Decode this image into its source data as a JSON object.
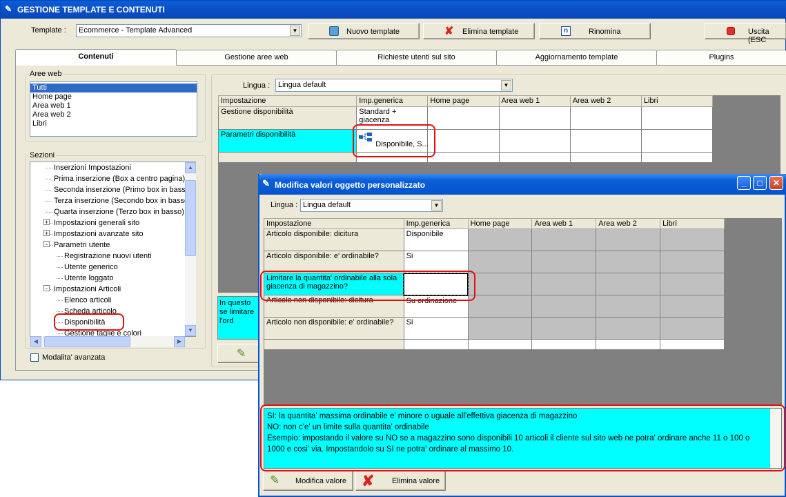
{
  "main_window": {
    "title": "GESTIONE TEMPLATE E CONTENUTI",
    "template_label": "Template :",
    "template_value": "Ecommerce - Template Advanced",
    "buttons": {
      "new_template": "Nuovo template",
      "delete_template": "Elimina template",
      "rename": "Rinomina",
      "exit": "Uscita (ESC"
    },
    "tabs": [
      "Contenuti",
      "Gestione aree web",
      "Richieste utenti sul sito",
      "Aggiornamento template",
      "Plugins"
    ],
    "aree_web": {
      "label": "Aree web",
      "items": [
        "Tutti",
        "Home page",
        "Area web 1",
        "Area web 2",
        "Libri"
      ],
      "selected": 0
    },
    "sezioni": {
      "label": "Sezioni",
      "items": [
        {
          "text": "Inserzioni Impostazioni",
          "indent": 1
        },
        {
          "text": "Prima inserzione (Box a centro pagina)",
          "indent": 1
        },
        {
          "text": "Seconda inserzione (Primo box in basso)",
          "indent": 1
        },
        {
          "text": "Terza inserzione (Secondo box in basso)",
          "indent": 1
        },
        {
          "text": "Quarta inserzione (Terzo box in basso)",
          "indent": 1
        },
        {
          "text": "Impostazioni generali sito",
          "indent": 1,
          "expander": "+"
        },
        {
          "text": "Impostazioni avanzate sito",
          "indent": 1,
          "expander": "+"
        },
        {
          "text": "Parametri utente",
          "indent": 1,
          "expander": "-"
        },
        {
          "text": "Registrazione nuovi utenti",
          "indent": 2
        },
        {
          "text": "Utente generico",
          "indent": 2
        },
        {
          "text": "Utente loggato",
          "indent": 2
        },
        {
          "text": "Impostazioni Articoli",
          "indent": 1,
          "expander": "-"
        },
        {
          "text": "Elenco articoli",
          "indent": 2
        },
        {
          "text": "Scheda articolo",
          "indent": 2
        },
        {
          "text": "Disponibilità",
          "indent": 2
        },
        {
          "text": "Gestione taglie e colori",
          "indent": 2
        }
      ]
    },
    "modalita_avanzata": "Modalita' avanzata",
    "lingua_label": "Lingua :",
    "lingua_value": "Lingua default",
    "grid": {
      "headers": [
        "Impostazione",
        "Imp.generica",
        "Home page",
        "Area web 1",
        "Area web 2",
        "Libri"
      ],
      "rows": [
        {
          "setting": "Gestione disponibilità",
          "generic": "Standard + giacenza"
        },
        {
          "setting": "Parametri disponibilità",
          "generic": "Disponibile, S..."
        }
      ]
    },
    "desc_partial": "In questo se limitare l'ord"
  },
  "dialog": {
    "title": "Modifica valori oggetto personalizzato",
    "lingua_label": "Lingua :",
    "lingua_value": "Lingua default",
    "grid": {
      "headers": [
        "Impostazione",
        "Imp.generica",
        "Home page",
        "Area web 1",
        "Area web 2",
        "Libri"
      ],
      "rows": [
        {
          "setting": "Articolo disponibile: dicitura",
          "generic": "Disponibile"
        },
        {
          "setting": "Articolo disponibile: e' ordinabile?",
          "generic": "Si"
        },
        {
          "setting": "Limitare la quantita' ordinabile alla sola giacenza di magazzino?",
          "generic": ""
        },
        {
          "setting": "Articolo non disponibile: dicitura",
          "generic": "Su ordinazione"
        },
        {
          "setting": "Articolo non disponibile: e' ordinabile?",
          "generic": "Si"
        }
      ]
    },
    "description": [
      "SI: la quantita' massima ordinabile e' minore o uguale all'effettiva giacenza di magazzino",
      "NO: non c'e' un limite sulla quantita' ordinabile",
      "Esempio: impostando il valore su NO se a magazzino sono disponibili 10 articoli il cliente sul sito web ne potra' ordinare anche 11 o 100 o 1000 e cosi' via. Impostandolo su SI ne potra' ordinare al massimo 10."
    ],
    "buttons": {
      "edit_value": "Modifica valore",
      "delete_value": "Elimina valore"
    }
  },
  "colors": {
    "window_bg": "#ece9d8",
    "highlight_cyan": "#00ffff",
    "selection_blue": "#316ac5",
    "annotation_red": "#e01010",
    "grid_bg_gray": "#808080"
  }
}
